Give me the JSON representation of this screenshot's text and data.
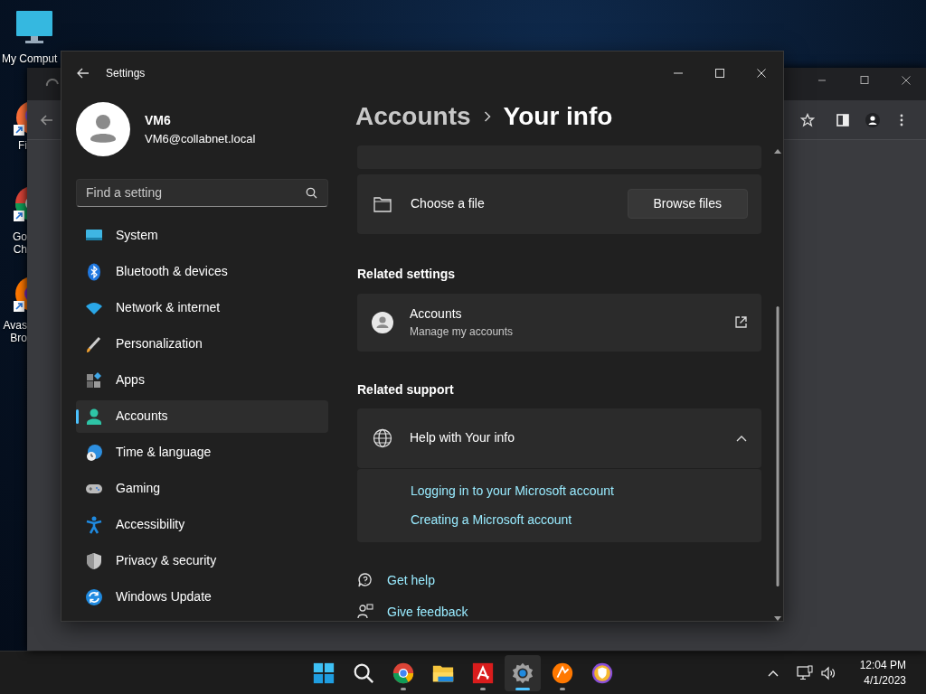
{
  "desktop_icons": [
    {
      "label": "My Comput",
      "kind": "computer",
      "shortcut": false
    },
    {
      "label": "Fi",
      "kind": "firefox",
      "shortcut": true
    },
    {
      "label": "Go Ch",
      "kind": "chrome",
      "shortcut": true
    },
    {
      "label": "Avas Bro",
      "kind": "avast",
      "shortcut": true
    }
  ],
  "settings_window": {
    "title": "Settings",
    "user": {
      "name": "VM6",
      "email": "VM6@collabnet.local"
    },
    "search": {
      "placeholder": "Find a setting"
    },
    "nav": [
      {
        "label": "System",
        "kind": "system",
        "selected": false
      },
      {
        "label": "Bluetooth & devices",
        "kind": "bluetooth",
        "selected": false
      },
      {
        "label": "Network & internet",
        "kind": "network",
        "selected": false
      },
      {
        "label": "Personalization",
        "kind": "personalization",
        "selected": false
      },
      {
        "label": "Apps",
        "kind": "apps",
        "selected": false
      },
      {
        "label": "Accounts",
        "kind": "accounts",
        "selected": true
      },
      {
        "label": "Time & language",
        "kind": "time",
        "selected": false
      },
      {
        "label": "Gaming",
        "kind": "gaming",
        "selected": false
      },
      {
        "label": "Accessibility",
        "kind": "accessibility",
        "selected": false
      },
      {
        "label": "Privacy & security",
        "kind": "privacy",
        "selected": false
      },
      {
        "label": "Windows Update",
        "kind": "update",
        "selected": false
      }
    ],
    "breadcrumb": {
      "parent": "Accounts",
      "current": "Your info"
    },
    "file_card": {
      "label": "Choose a file",
      "button": "Browse files"
    },
    "related_settings": {
      "heading": "Related settings",
      "items": [
        {
          "title": "Accounts",
          "subtitle": "Manage my accounts"
        }
      ]
    },
    "related_support": {
      "heading": "Related support",
      "expander": {
        "title": "Help with Your info",
        "expanded": true,
        "links": [
          "Logging in to your Microsoft account",
          "Creating a Microsoft account"
        ]
      }
    },
    "footer_links": [
      {
        "label": "Get help",
        "kind": "help"
      },
      {
        "label": "Give feedback",
        "kind": "feedback"
      }
    ]
  },
  "taskbar": {
    "apps": [
      {
        "kind": "start",
        "running": false,
        "active": false
      },
      {
        "kind": "search",
        "running": false,
        "active": false
      },
      {
        "kind": "chrome",
        "running": true,
        "active": false
      },
      {
        "kind": "explorer",
        "running": false,
        "active": false
      },
      {
        "kind": "avira",
        "running": true,
        "active": false
      },
      {
        "kind": "settings",
        "running": true,
        "active": true
      },
      {
        "kind": "avast",
        "running": true,
        "active": false
      },
      {
        "kind": "vpn",
        "running": false,
        "active": false
      }
    ],
    "time": "12:04 PM",
    "date": "4/1/2023"
  }
}
